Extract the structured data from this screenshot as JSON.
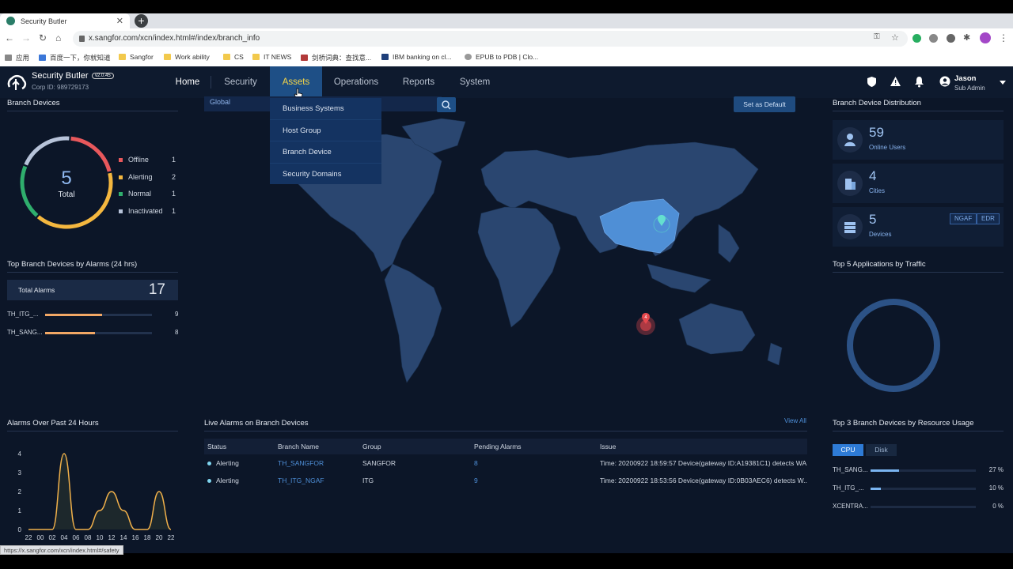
{
  "browser": {
    "tab_title": "Security Butler",
    "url": "x.sangfor.com/xcn/index.html#/index/branch_info",
    "bookmarks": [
      "应用",
      "百度一下，你就知道",
      "Sangfor",
      "Work ability",
      "CS",
      "IT NEWS",
      "剑桥词典：查找意...",
      "IBM banking on cl...",
      "EPUB to PDB | Clo..."
    ],
    "status_url": "https://x.sangfor.com/xcn/index.html#/safety"
  },
  "header": {
    "brand": "Security Butler",
    "version": "v2.0.45",
    "corp_id": "Corp ID: 989729173",
    "nav": [
      "Home",
      "Security",
      "Assets",
      "Operations",
      "Reports",
      "System"
    ],
    "active_nav": "Assets",
    "user_name": "Jason",
    "user_role": "Sub Admin"
  },
  "assets_menu": [
    "Business Systems",
    "Host Group",
    "Branch Device",
    "Security Domains"
  ],
  "branch_devices": {
    "title": "Branch Devices",
    "total": "5",
    "total_label": "Total",
    "legend": [
      {
        "label": "Offline",
        "value": "1",
        "color": "#e8585c"
      },
      {
        "label": "Alerting",
        "value": "2",
        "color": "#f4b73f"
      },
      {
        "label": "Normal",
        "value": "1",
        "color": "#2fae6d"
      },
      {
        "label": "Inactivated",
        "value": "1",
        "color": "#b7c3d9"
      }
    ]
  },
  "top_alarms": {
    "title": "Top Branch Devices by Alarms (24 hrs)",
    "total_label": "Total Alarms",
    "total": "17",
    "items": [
      {
        "name": "TH_ITG_...",
        "value": "9",
        "fraction": 0.53
      },
      {
        "name": "TH_SANG...",
        "value": "8",
        "fraction": 0.47
      }
    ]
  },
  "map": {
    "region": "Global",
    "set_default": "Set as Default",
    "marker_count": "4"
  },
  "distribution": {
    "title": "Branch Device Distribution",
    "online_users": "59",
    "online_users_label": "Online Users",
    "cities": "4",
    "cities_label": "Cities",
    "devices": "5",
    "devices_label": "Devices",
    "tags": [
      "NGAF",
      "EDR"
    ]
  },
  "top_apps": {
    "title": "Top 5 Applications by Traffic"
  },
  "alarms_chart": {
    "title": "Alarms Over Past 24 Hours",
    "chart_data": {
      "type": "area",
      "x": [
        "22",
        "00",
        "02",
        "04",
        "06",
        "08",
        "10",
        "12",
        "14",
        "16",
        "18",
        "20",
        "22"
      ],
      "y_ticks": [
        "0",
        "1",
        "2",
        "3",
        "4"
      ],
      "ylim": [
        0,
        4
      ],
      "values": [
        0,
        0,
        0,
        4,
        0,
        0,
        1,
        2,
        1,
        0,
        0,
        2,
        0
      ]
    }
  },
  "live_alarms": {
    "title": "Live Alarms on Branch Devices",
    "view_all": "View All",
    "columns": [
      "Status",
      "Branch Name",
      "Group",
      "Pending Alarms",
      "Issue"
    ],
    "rows": [
      {
        "status": "Alerting",
        "branch": "TH_SANGFOR",
        "group": "SANGFOR",
        "pending": "8",
        "issue": "Time: 20200922 18:59:57 Device(gateway ID:A19381C1) detects WA..."
      },
      {
        "status": "Alerting",
        "branch": "TH_ITG_NGAF",
        "group": "ITG",
        "pending": "9",
        "issue": "Time: 20200922 18:53:56 Device(gateway ID:0B03AEC6) detects W..."
      }
    ]
  },
  "resource_usage": {
    "title": "Top 3 Branch Devices by Resource Usage",
    "tabs": [
      "CPU",
      "Disk"
    ],
    "items": [
      {
        "name": "TH_SANG...",
        "value": "27 %",
        "fraction": 0.27
      },
      {
        "name": "TH_ITG_...",
        "value": "10 %",
        "fraction": 0.1
      },
      {
        "name": "XCENTRA...",
        "value": "0 %",
        "fraction": 0
      }
    ]
  }
}
